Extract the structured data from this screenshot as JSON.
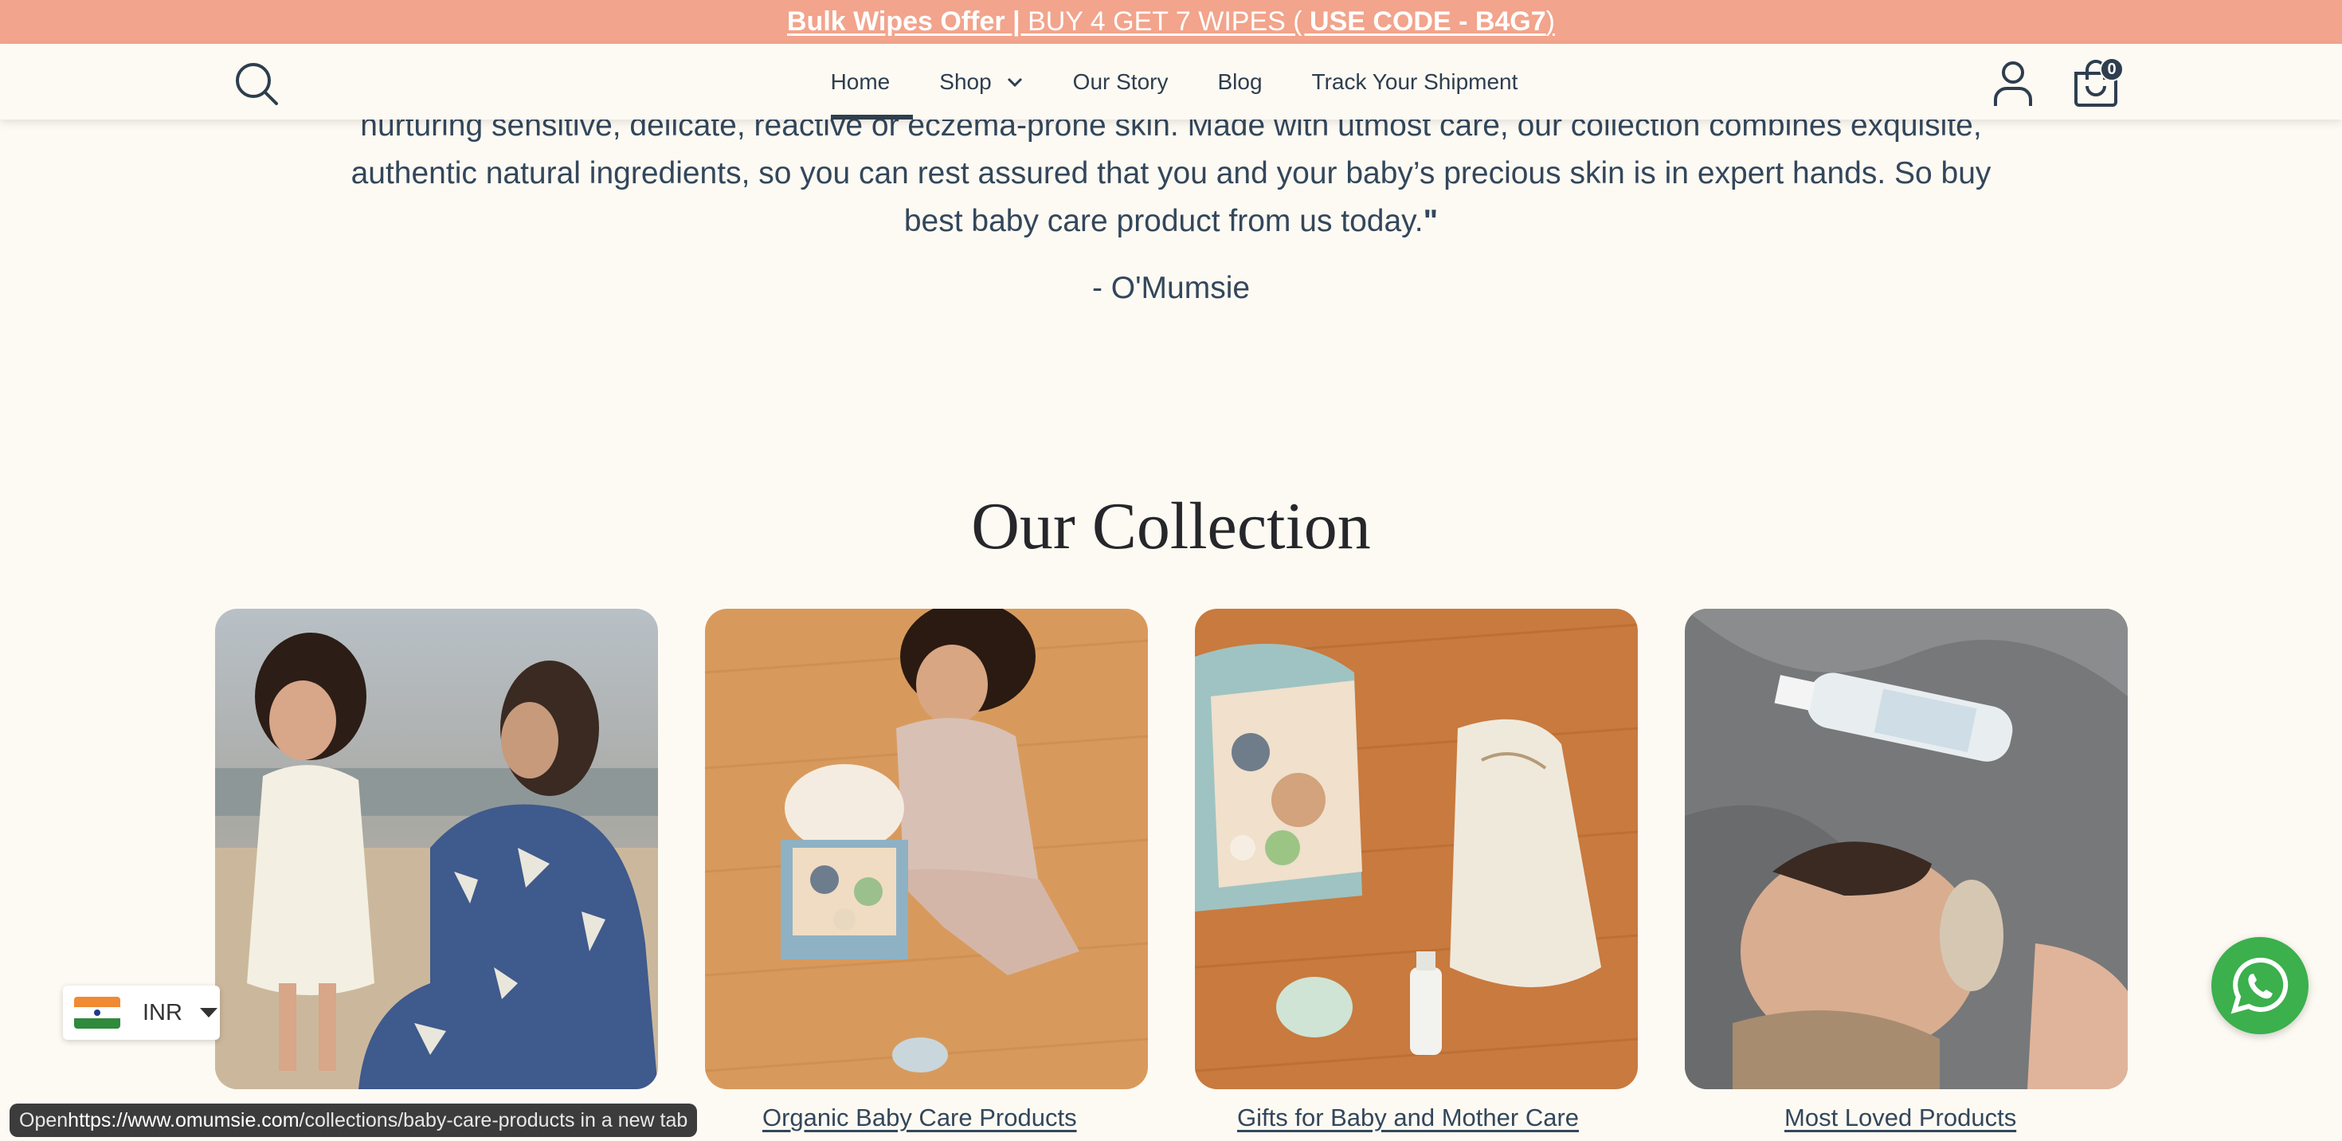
{
  "announcement": {
    "offer_bold": "Bulk Wipes Offer | ",
    "offer_text": "BUY 4 GET 7 WIPES ( ",
    "code": "USE CODE - B4G7",
    "close": ")"
  },
  "header": {
    "nav": [
      {
        "label": "Home"
      },
      {
        "label": "Shop"
      },
      {
        "label": "Our Story"
      },
      {
        "label": "Blog"
      },
      {
        "label": "Track Your Shipment"
      }
    ],
    "cart_count": "0"
  },
  "testimonial": {
    "line1": "nurturing sensitive, delicate, reactive or eczema-prone skin. Made with utmost care, our collection combines exquisite,",
    "line2": "authentic natural ingredients, so you can rest assured that you and your baby’s precious skin is in expert hands. So buy",
    "line3": "best baby care product from us today.",
    "close_mark": "\"",
    "author": "- O'Mumsie"
  },
  "collection": {
    "title": "Our Collection",
    "items": [
      {
        "label": "Organic Baby Care Products"
      },
      {
        "label": "Gifts for Baby and Mother Care"
      },
      {
        "label": "Most Loved Products"
      }
    ]
  },
  "currency": {
    "code": "INR"
  },
  "status_bar": {
    "prefix": "Open ",
    "url": "https://www.omumsie.com",
    "path": "/collections/baby-care-products in a new tab"
  },
  "colors": {
    "announcement_bg": "#f2a48c",
    "page_bg": "#fdfaf3",
    "text": "#2e3e4e",
    "whatsapp": "#3bb04c"
  }
}
